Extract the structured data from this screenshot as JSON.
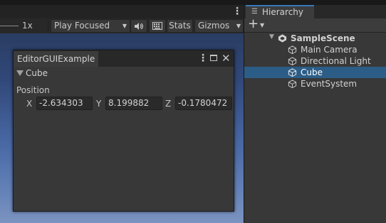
{
  "game_view": {
    "toolbar": {
      "scale_label": "1x",
      "play_mode": "Play Focused",
      "stats_label": "Stats",
      "gizmos_label": "Gizmos"
    }
  },
  "editor_window": {
    "title": "EditorGUIExample",
    "foldout_label": "Cube",
    "position_label": "Position",
    "fields": [
      {
        "axis": "X",
        "value": "-2.634303"
      },
      {
        "axis": "Y",
        "value": "8.199882"
      },
      {
        "axis": "Z",
        "value": "-0.1780472"
      }
    ]
  },
  "hierarchy": {
    "tab_label": "Hierarchy",
    "scene_name": "SampleScene",
    "items": [
      {
        "label": "Main Camera",
        "selected": false
      },
      {
        "label": "Directional Light",
        "selected": false
      },
      {
        "label": "Cube",
        "selected": true
      },
      {
        "label": "EventSystem",
        "selected": false
      }
    ]
  },
  "colors": {
    "selection": "#2c5d87",
    "active_tab_accent": "#3a79bb"
  },
  "icons": [
    "kebab-menu-icon",
    "dropdown-arrow-icon",
    "speaker-icon",
    "keyboard-icon",
    "maximize-icon",
    "close-icon",
    "foldout-arrow-icon",
    "list-icon",
    "add-icon",
    "expand-arrow-icon",
    "unity-scene-icon",
    "gameobject-cube-icon"
  ]
}
